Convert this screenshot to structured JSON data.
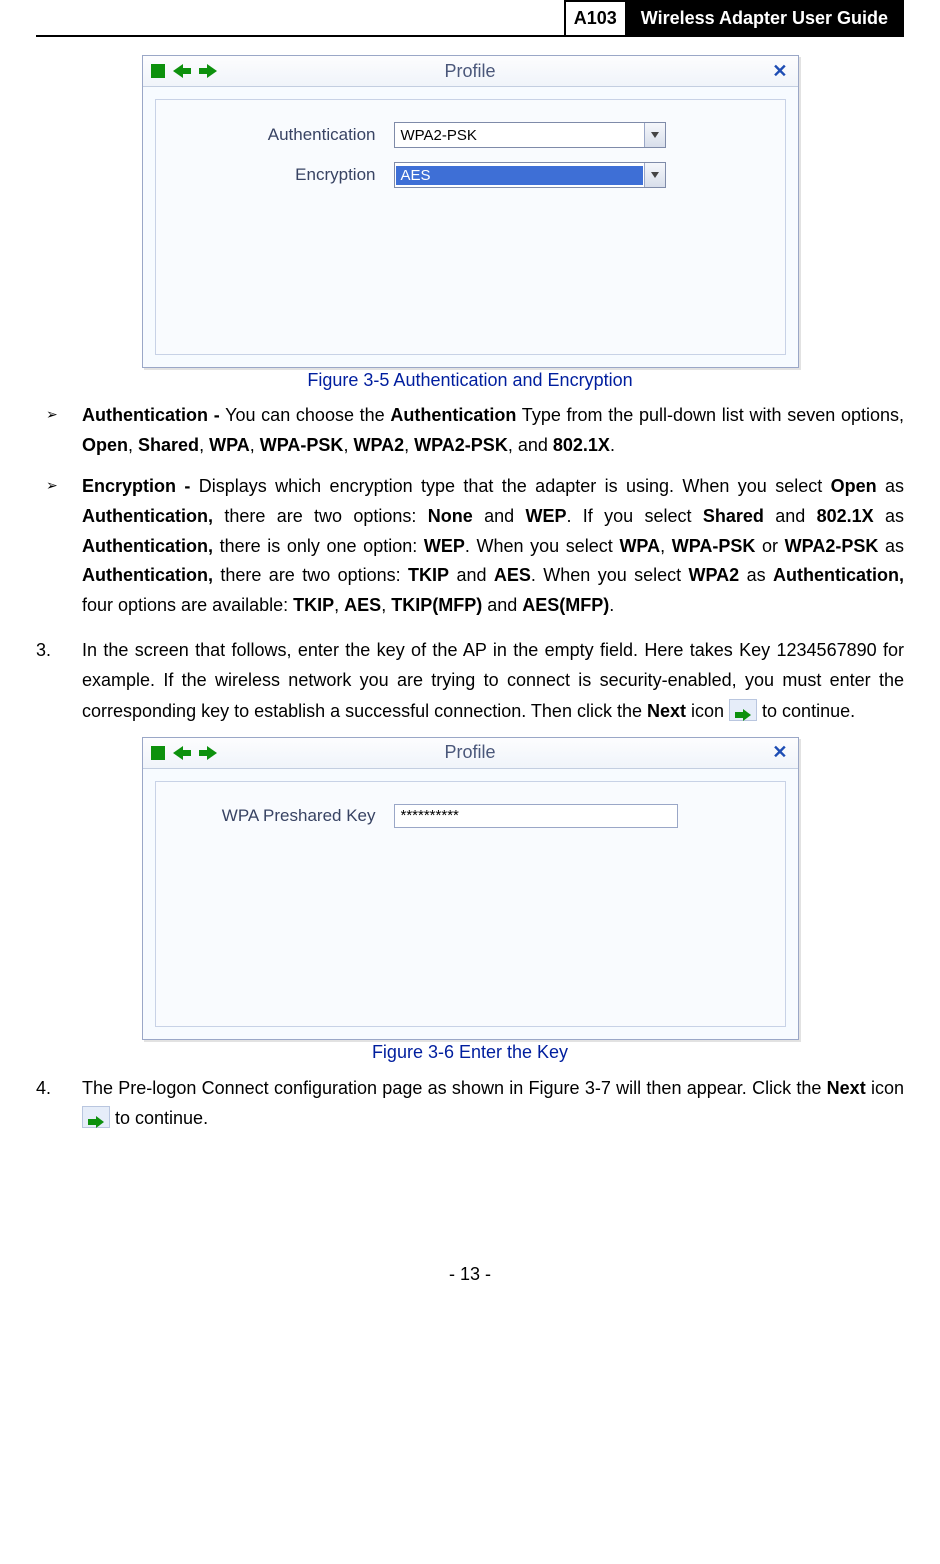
{
  "header": {
    "model": "A103",
    "title": "Wireless Adapter User Guide"
  },
  "dialog1": {
    "title": "Profile",
    "auth_label": "Authentication",
    "auth_value": "WPA2-PSK",
    "enc_label": "Encryption",
    "enc_value": "AES"
  },
  "caption1": "Figure 3-5 Authentication and Encryption",
  "bullets": {
    "auth": {
      "term": "Authentication -",
      "lead1": " You can choose the ",
      "k1": "Authentication",
      "lead2": " Type from the pull-down list with seven options, ",
      "opts": [
        "Open",
        "Shared",
        "WPA",
        "WPA-PSK",
        "WPA2",
        "WPA2-PSK",
        "802.1X"
      ],
      "tail": "."
    },
    "enc": {
      "term": "Encryption -",
      "t1": " Displays which encryption type that the adapter is using. When you select ",
      "k1": "Open",
      "t2": " as ",
      "k2": "Authentication,",
      "t3": " there are two options: ",
      "k3": "None",
      "t4": " and ",
      "k4": "WEP",
      "t5": ". If you select ",
      "k5": "Shared",
      "t6": " and ",
      "k6": "802.1X",
      "t7": " as ",
      "k7": "Authentication,",
      "t8": " there is only one option: ",
      "k8": "WEP",
      "t9": ". When you select ",
      "k9": "WPA",
      "t10": ", ",
      "k10": "WPA-PSK",
      "t11": " or ",
      "k11": "WPA2-PSK",
      "t12": " as ",
      "k12": "Authentication,",
      "t13": " there are two options: ",
      "k13": "TKIP",
      "t14": " and ",
      "k14": "AES",
      "t15": ". When you select ",
      "k15": "WPA2",
      "t16": " as ",
      "k16": "Authentication,",
      "t17": " four options are available: ",
      "k17": "TKIP",
      "t18": ", ",
      "k18": "AES",
      "t19": ", ",
      "k19": "TKIP(MFP)",
      "t20": " and ",
      "k20": "AES(MFP)",
      "t21": "."
    }
  },
  "step3": {
    "num": "3.",
    "t1": "In the screen that follows, enter the key of the AP in the empty field. Here takes Key 1234567890 for example. If the wireless network you are trying to connect is security-enabled, you must enter the corresponding key to establish a successful connection. Then click the ",
    "k1": "Next",
    "t2": " icon ",
    "t3": " to continue."
  },
  "dialog2": {
    "title": "Profile",
    "key_label": "WPA Preshared Key",
    "key_value": "**********"
  },
  "caption2": "Figure 3-6 Enter the Key",
  "step4": {
    "num": "4.",
    "t1": "The Pre-logon Connect configuration page as shown in Figure 3-7 will then appear. Click the ",
    "k1": "Next",
    "t2": " icon ",
    "t3": " to continue."
  },
  "footer": "- 13 -"
}
